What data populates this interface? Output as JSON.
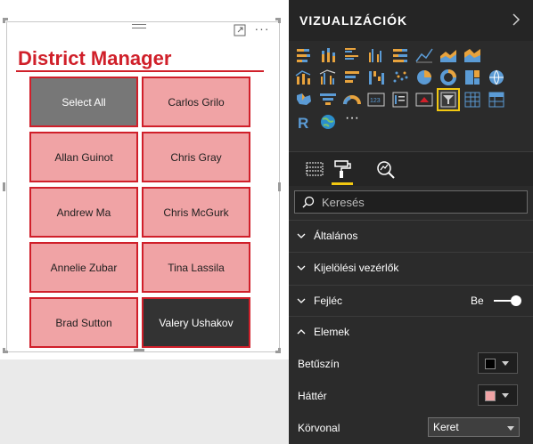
{
  "canvas": {
    "visual_title": "District Manager",
    "more_options_label": "···",
    "slicer_items": [
      {
        "label": "Select All",
        "state": "selected-all"
      },
      {
        "label": "Carlos Grilo",
        "state": "normal"
      },
      {
        "label": "Allan Guinot",
        "state": "normal"
      },
      {
        "label": "Chris Gray",
        "state": "normal"
      },
      {
        "label": "Andrew Ma",
        "state": "normal"
      },
      {
        "label": "Chris McGurk",
        "state": "normal"
      },
      {
        "label": "Annelie Zubar",
        "state": "normal"
      },
      {
        "label": "Tina Lassila",
        "state": "normal"
      },
      {
        "label": "Brad Sutton",
        "state": "normal"
      },
      {
        "label": "Valery Ushakov",
        "state": "selected"
      }
    ],
    "colors": {
      "title": "#d0202a",
      "item_bg": "#f0a3a5",
      "item_border": "#d01f2a",
      "select_all_bg": "#777777",
      "selected_bg": "#333333"
    }
  },
  "pane": {
    "title": "VIZUALIZÁCIÓK",
    "viz_icons": [
      "stacked-bar-icon",
      "stacked-column-icon",
      "clustered-bar-icon",
      "clustered-column-icon",
      "100-percent-bar-icon",
      "line-chart-icon",
      "area-chart-icon",
      "stacked-area-icon",
      "line-column-icon",
      "line-clustered-column-icon",
      "ribbon-chart-icon",
      "waterfall-chart-icon",
      "scatter-chart-icon",
      "pie-chart-icon",
      "donut-chart-icon",
      "treemap-icon",
      "map-icon",
      "filled-map-icon",
      "funnel-icon",
      "gauge-icon",
      "card-icon",
      "multi-row-card-icon",
      "kpi-icon",
      "slicer-icon",
      "table-icon",
      "matrix-icon",
      "r-script-icon",
      "globe-icon",
      "more-visuals-icon"
    ],
    "selected_icon": "slicer-icon",
    "tabs": [
      "fields-tab",
      "format-tab",
      "analytics-tab"
    ],
    "active_tab": "format-tab",
    "search_placeholder": "Keresés",
    "sections": {
      "general": "Általános",
      "selection_controls": "Kijelölési vezérlők",
      "header": "Fejléc",
      "items": "Elemek"
    },
    "header_toggle": {
      "label": "Be",
      "on": true
    },
    "properties": {
      "font_color_label": "Betűszín",
      "font_color": "#000000",
      "background_label": "Háttér",
      "background_color": "#f0a3a5",
      "outline_label": "Körvonal",
      "outline_value": "Keret"
    },
    "colors": {
      "accent": "#f2c811",
      "pane_bg": "#2b2b2b"
    }
  }
}
